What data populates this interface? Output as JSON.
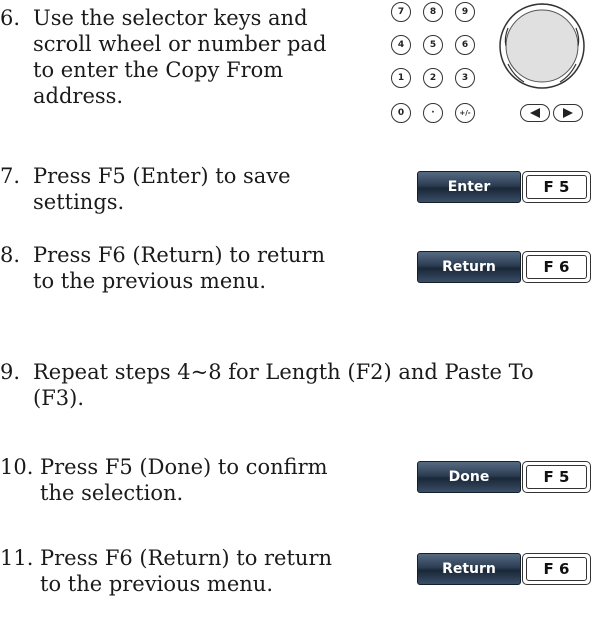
{
  "steps": [
    {
      "num": "6.",
      "lines": [
        "Use the selector keys and",
        "scroll wheel or number pad",
        "to enter the Copy From",
        "address."
      ]
    },
    {
      "num": "7.",
      "lines": [
        "Press F5 (Enter) to save",
        "settings."
      ],
      "softkey": "Enter",
      "fkey": "F 5"
    },
    {
      "num": "8.",
      "lines": [
        "Press F6 (Return) to return",
        "to the previous menu."
      ],
      "softkey": "Return",
      "fkey": "F 6"
    },
    {
      "num": "9.",
      "lines": [
        "Repeat steps 4~8 for Length (F2) and Paste To",
        "(F3)."
      ]
    },
    {
      "num": "10.",
      "lines": [
        "Press F5 (Done) to confirm",
        "the selection."
      ],
      "softkey": "Done",
      "fkey": "F 5"
    },
    {
      "num": "11.",
      "lines": [
        "Press F6 (Return) to return",
        "to the previous menu."
      ],
      "softkey": "Return",
      "fkey": "F 6"
    }
  ],
  "keypad": {
    "keys": [
      "7",
      "8",
      "9",
      "4",
      "5",
      "6",
      "1",
      "2",
      "3",
      "0",
      "·",
      "+/-"
    ],
    "arrows": [
      "left-arrow-icon",
      "right-arrow-icon"
    ]
  }
}
